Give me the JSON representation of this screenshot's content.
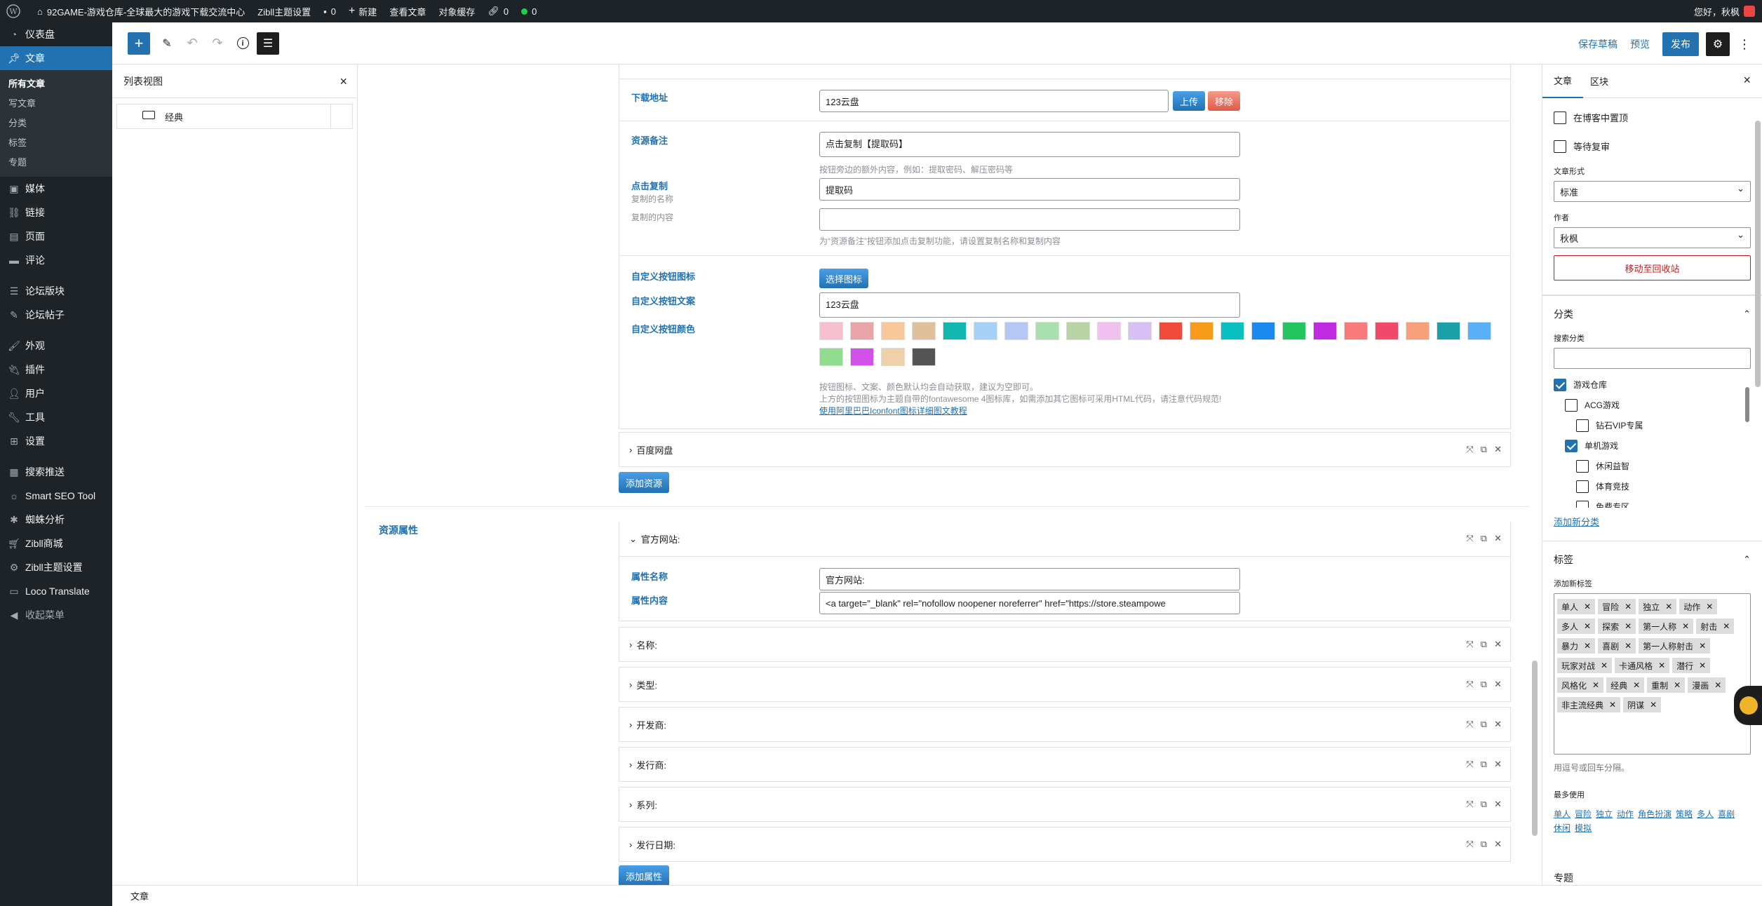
{
  "adminbar": {
    "site_name": "92GAME-游戏仓库-全球最大的游戏下载交流中心",
    "theme_settings": "Zibll主题设置",
    "comments": "0",
    "new": "新建",
    "view_post": "查看文章",
    "object_cache": "对象缓存",
    "links": "0",
    "status": "0",
    "greeting": "您好，秋枫"
  },
  "menu": {
    "dashboard": "仪表盘",
    "posts": "文章",
    "posts_sub": [
      "所有文章",
      "写文章",
      "分类",
      "标签",
      "专题"
    ],
    "media": "媒体",
    "links": "链接",
    "pages": "页面",
    "comments": "评论",
    "forum_boards": "论坛版块",
    "forum_posts": "论坛帖子",
    "appearance": "外观",
    "plugins": "插件",
    "users": "用户",
    "tools": "工具",
    "settings": "设置",
    "search_push": "搜索推送",
    "smart_seo": "Smart SEO Tool",
    "spider": "蜘蛛分析",
    "zibll_shop": "Zibll商城",
    "zibll_settings": "Zibll主题设置",
    "loco": "Loco Translate",
    "collapse": "收起菜单"
  },
  "header": {
    "save_draft": "保存草稿",
    "preview": "预览",
    "publish": "发布"
  },
  "listview": {
    "title": "列表视图",
    "item": "经典"
  },
  "resource": {
    "download_label": "下载地址",
    "download_value": "123云盘",
    "upload": "上传",
    "remove": "移除",
    "note_label": "资源备注",
    "note_value": "点击复制【提取码】",
    "note_help": "按钮旁边的额外内容，例如：提取密码、解压密码等",
    "copy_label": "点击复制",
    "copy_name_label": "复制的名称",
    "copy_name_value": "提取码",
    "copy_content_label": "复制的内容",
    "copy_content_value": "",
    "copy_help": "为“资源备注”按钮添加点击复制功能，请设置复制名称和复制内容",
    "icon_label": "自定义按钮图标",
    "icon_btn": "选择图标",
    "text_label": "自定义按钮文案",
    "text_value": "123云盘",
    "color_label": "自定义按钮颜色",
    "swatches": [
      "#f8bfcf",
      "#e8a5a8",
      "#f8c89a",
      "#e0c09a",
      "#12b8b0",
      "#a5d0f8",
      "#b5c8f5",
      "#a8e0b0",
      "#b8d4a5",
      "#f0c0f0",
      "#d8c0f5",
      "#f04a3a",
      "#f89a1a",
      "#0abfbf",
      "#1a8af0",
      "#22c55e",
      "#c02ae0",
      "#f87a7a",
      "#f04a6a",
      "#f8a07a",
      "#1aa0a8",
      "#5ab0f8",
      "#90dd90",
      "#d050e8",
      "#f0d0a8",
      "#555555"
    ],
    "color_help": [
      "按钮图标、文案、颜色默认均会自动获取，建议为空即可。",
      "上方的按钮图标为主题自带的fontawesome 4图标库，如需添加其它图标可采用HTML代码，请注意代码规范!"
    ],
    "color_link": "使用阿里巴巴Iconfont图标详细图文教程",
    "baidu": "百度网盘",
    "add_resource": "添加资源"
  },
  "attrs": {
    "section_label": "资源属性",
    "official": "官方网站:",
    "name_label": "属性名称",
    "name_value": "官方网站:",
    "content_label": "属性内容",
    "content_value": "<a target=\"_blank\" rel=\"nofollow noopener noreferrer\" href=\"https://store.steampowe",
    "groups": [
      "名称:",
      "类型:",
      "开发商:",
      "发行商:",
      "系列:",
      "发行日期:"
    ],
    "add_attr": "添加属性"
  },
  "sidebar": {
    "tab_post": "文章",
    "tab_block": "区块",
    "sticky": "在博客中置顶",
    "pending": "等待复审",
    "format_label": "文章形式",
    "format_value": "标准",
    "author_label": "作者",
    "author_value": "秋枫",
    "trash": "移动至回收站",
    "categories_title": "分类",
    "search_cat": "搜索分类",
    "categories": [
      {
        "name": "游戏仓库",
        "checked": true,
        "level": 0
      },
      {
        "name": "ACG游戏",
        "checked": false,
        "level": 1
      },
      {
        "name": "钻石VIP专属",
        "checked": false,
        "level": 2
      },
      {
        "name": "单机游戏",
        "checked": true,
        "level": 1
      },
      {
        "name": "休闲益智",
        "checked": false,
        "level": 2
      },
      {
        "name": "体育竞技",
        "checked": false,
        "level": 2
      },
      {
        "name": "免费专区",
        "checked": false,
        "level": 2
      }
    ],
    "add_cat": "添加新分类",
    "tags_title": "标签",
    "add_tag": "添加新标签",
    "tags": [
      "单人",
      "冒险",
      "独立",
      "动作",
      "多人",
      "探索",
      "第一人称",
      "射击",
      "暴力",
      "喜剧",
      "第一人称射击",
      "玩家对战",
      "卡通风格",
      "潜行",
      "风格化",
      "经典",
      "重制",
      "漫画",
      "非主流经典",
      "阴谋"
    ],
    "tag_help": "用逗号或回车分隔。",
    "most_used": "最多使用",
    "most_used_tags": [
      "单人",
      "冒险",
      "独立",
      "动作",
      "角色扮演",
      "策略",
      "多人",
      "喜剧",
      "休闲",
      "模拟"
    ],
    "bottom": "专题"
  },
  "footer": {
    "breadcrumb": "文章"
  }
}
